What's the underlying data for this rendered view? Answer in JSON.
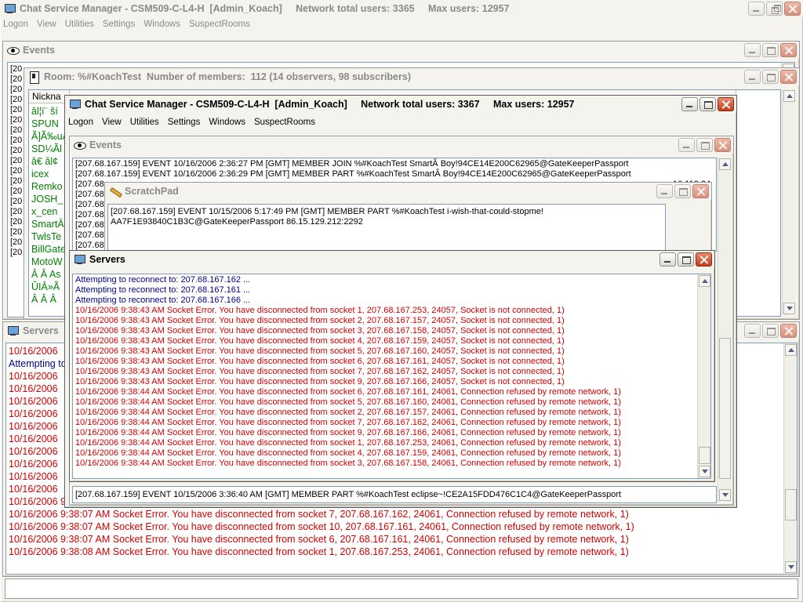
{
  "main_window": {
    "title": "Chat Service Manager - CSM509-C-L4-H  [Admin_Koach]     Network total users: 3365     Max users: 12957",
    "menu": [
      "Logon",
      "View",
      "Utilities",
      "Settings",
      "Windows",
      "SuspectRooms"
    ]
  },
  "bg_events": {
    "title": "Events",
    "line_prefixes": [
      "[20",
      "[20",
      "[20",
      "[20",
      "[20",
      "[20",
      "[20",
      "[20",
      "[20",
      "[20",
      "[20",
      "[20",
      "[20",
      "[20",
      "[20",
      "[20",
      "[20",
      "[20",
      "[20"
    ]
  },
  "room": {
    "title": "Room: %#KoachTest  Number of members:  112 (14 observers, 98 subscribers)",
    "column_header": "Nickna",
    "nicknames": [
      "âl¦ï¨ ší",
      "SPUN",
      "Ã]Ã‰uÂ",
      "SD¼Ãl",
      "â€ âl¢",
      "icex",
      "Remko",
      "JOSH_",
      "x_cen",
      "SmartÂ",
      "TwlsTe",
      "BillGate",
      "MotoW",
      "Â Â As",
      "ÛIÂ»Ã",
      "Â Â Â"
    ]
  },
  "bg_servers": {
    "title": "Servers",
    "lines": [
      {
        "text": "10/16/2006",
        "color": "red"
      },
      {
        "text": "Attempting to",
        "color": "blue"
      },
      {
        "text": "10/16/2006",
        "color": "red"
      },
      {
        "text": "10/16/2006",
        "color": "red"
      },
      {
        "text": "10/16/2006",
        "color": "red"
      },
      {
        "text": "10/16/2006",
        "color": "red"
      },
      {
        "text": "10/16/2006",
        "color": "red"
      },
      {
        "text": "10/16/2006",
        "color": "red"
      },
      {
        "text": "10/16/2006",
        "color": "red"
      },
      {
        "text": "10/16/2006",
        "color": "red"
      },
      {
        "text": "10/16/2006",
        "color": "red"
      },
      {
        "text": "10/16/2006",
        "color": "red"
      },
      {
        "text": "10/16/2006 9:38:07 AM Socket Error. You have disconnected from socket 5, 207.68.167.160, 24061, Connection refused by remote network, 1)",
        "color": "red"
      },
      {
        "text": "10/16/2006 9:38:07 AM Socket Error. You have disconnected from socket 7, 207.68.167.162, 24061, Connection refused by remote network, 1)",
        "color": "red"
      },
      {
        "text": "10/16/2006 9:38:07 AM Socket Error. You have disconnected from socket 10, 207.68.167.161, 24061, Connection refused by remote network, 1)",
        "color": "red"
      },
      {
        "text": "10/16/2006 9:38:07 AM Socket Error. You have disconnected from socket 6, 207.68.167.161, 24061, Connection refused by remote network, 1)",
        "color": "red"
      },
      {
        "text": "10/16/2006 9:38:08 AM Socket Error. You have disconnected from socket 1, 207.68.167.253, 24061, Connection refused by remote network, 1)",
        "color": "red"
      }
    ]
  },
  "second_window": {
    "title": "Chat Service Manager - CSM509-C-L4-H  [Admin_Koach]     Network total users: 3367     Max users: 12957",
    "menu": [
      "Logon",
      "View",
      "Utilities",
      "Settings",
      "Windows",
      "SuspectRooms"
    ]
  },
  "events2": {
    "title": "Events",
    "lines": [
      "[207.68.167.159] EVENT 10/16/2006 2:36:27 PM [GMT]  MEMBER JOIN %#KoachTest SmartÂ Boy!94CE14E200C62965@GateKeeperPassport",
      "[207.68.167.159] EVENT 10/16/2006 2:36:29 PM [GMT]  MEMBER PART %#KoachTest SmartÂ Boy!94CE14E200C62965@GateKeeperPassport",
      "[207.68",
      "[207.68",
      "[207.68",
      "[207.68",
      "[207.68",
      "[207.68",
      "[207.68",
      "[207.68"
    ],
    "right_fragments": [
      "10.112.24",
      "10938",
      "4:17922",
      "34:17922",
      "10218",
      "24:1740"
    ]
  },
  "scratchpad": {
    "title": "ScratchPad",
    "text_line1": "[207.68.167.159] EVENT 10/15/2006 5:17:49 PM [GMT]  MEMBER PART %#KoachTest i-wish-that-could-stopme!",
    "text_line2": "AA7F1E93840C1B3C@GateKeeperPassport 86.15.129.212:2292"
  },
  "servers": {
    "title": "Servers",
    "lines": [
      {
        "text": "Attempting to reconnect to: 207.68.167.162 ...",
        "color": "blue"
      },
      {
        "text": "Attempting to reconnect to: 207.68.167.161 ...",
        "color": "blue"
      },
      {
        "text": "Attempting to reconnect to: 207.68.167.166 ...",
        "color": "blue"
      },
      {
        "text": "10/16/2006 9:38:43 AM Socket Error. You have disconnected from socket 1, 207.68.167.253, 24057, Socket is not connected, 1)",
        "color": "red"
      },
      {
        "text": "10/16/2006 9:38:43 AM Socket Error. You have disconnected from socket 2, 207.68.167.157, 24057, Socket is not connected, 1)",
        "color": "red"
      },
      {
        "text": "10/16/2006 9:38:43 AM Socket Error. You have disconnected from socket 3, 207.68.167.158, 24057, Socket is not connected, 1)",
        "color": "red"
      },
      {
        "text": "10/16/2006 9:38:43 AM Socket Error. You have disconnected from socket 4, 207.68.167.159, 24057, Socket is not connected, 1)",
        "color": "red"
      },
      {
        "text": "10/16/2006 9:38:43 AM Socket Error. You have disconnected from socket 5, 207.68.167.160, 24057, Socket is not connected, 1)",
        "color": "red"
      },
      {
        "text": "10/16/2006 9:38:43 AM Socket Error. You have disconnected from socket 6, 207.68.167.161, 24057, Socket is not connected, 1)",
        "color": "red"
      },
      {
        "text": "10/16/2006 9:38:43 AM Socket Error. You have disconnected from socket 7, 207.68.167.162, 24057, Socket is not connected, 1)",
        "color": "red"
      },
      {
        "text": "10/16/2006 9:38:43 AM Socket Error. You have disconnected from socket 9, 207.68.167.166, 24057, Socket is not connected, 1)",
        "color": "red"
      },
      {
        "text": "10/16/2006 9:38:44 AM Socket Error. You have disconnected from socket 6, 207.68.167.161, 24061, Connection refused by remote network, 1)",
        "color": "red"
      },
      {
        "text": "10/16/2006 9:38:44 AM Socket Error. You have disconnected from socket 5, 207.68.167.160, 24061, Connection refused by remote network, 1)",
        "color": "red"
      },
      {
        "text": "10/16/2006 9:38:44 AM Socket Error. You have disconnected from socket 2, 207.68.167.157, 24061, Connection refused by remote network, 1)",
        "color": "red"
      },
      {
        "text": "10/16/2006 9:38:44 AM Socket Error. You have disconnected from socket 7, 207.68.167.162, 24061, Connection refused by remote network, 1)",
        "color": "red"
      },
      {
        "text": "10/16/2006 9:38:44 AM Socket Error. You have disconnected from socket 9, 207.68.167.166, 24061, Connection refused by remote network, 1)",
        "color": "red"
      },
      {
        "text": "10/16/2006 9:38:44 AM Socket Error. You have disconnected from socket 1, 207.68.167.253, 24061, Connection refused by remote network, 1)",
        "color": "red"
      },
      {
        "text": "10/16/2006 9:38:44 AM Socket Error. You have disconnected from socket 4, 207.68.167.159, 24061, Connection refused by remote network, 1)",
        "color": "red"
      },
      {
        "text": "10/16/2006 9:38:44 AM Socket Error. You have disconnected from socket 3, 207.68.167.158, 24061, Connection refused by remote network, 1)",
        "color": "red"
      }
    ],
    "bottom_event": "[207.68.167.159] EVENT 10/15/2006 3:36:40 AM [GMT]  MEMBER PART %#KoachTest eclipse~!CE2A15FDD476C1C4@GateKeeperPassport"
  },
  "colors": {
    "error_text": "#d40000",
    "info_text": "#00008b",
    "nickname_text": "#008000"
  }
}
